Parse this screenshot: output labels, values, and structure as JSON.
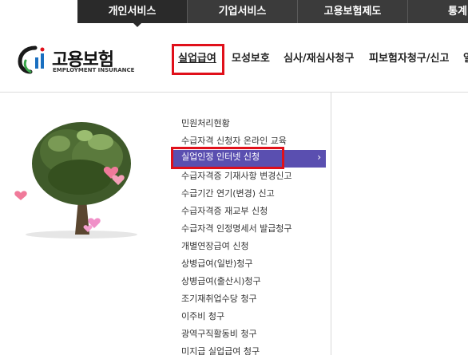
{
  "topnav": {
    "items": [
      {
        "label": "개인서비스"
      },
      {
        "label": "기업서비스"
      },
      {
        "label": "고용보험제도"
      },
      {
        "label": "통계"
      }
    ]
  },
  "logo": {
    "kor": "고용보험",
    "eng": "EMPLOYMENT INSURANCE"
  },
  "mainnav": {
    "items": [
      {
        "label": "실업급여"
      },
      {
        "label": "모성보호"
      },
      {
        "label": "심사/재심사청구"
      },
      {
        "label": "피보험자청구/신고"
      },
      {
        "label": "일"
      }
    ]
  },
  "submenu": {
    "items": [
      {
        "label": "민원처리현황"
      },
      {
        "label": "수급자격 신청자 온라인 교육"
      },
      {
        "label": "실업인정 인터넷 신청"
      },
      {
        "label": "수급자격증 기재사항 변경신고"
      },
      {
        "label": "수급기간 연기(변경) 신고"
      },
      {
        "label": "수급자격증 재교부 신청"
      },
      {
        "label": "수급자격 인정명세서 발급청구"
      },
      {
        "label": "개별연장급여 신청"
      },
      {
        "label": "상병급여(일반)청구"
      },
      {
        "label": "상병급여(출산시)청구"
      },
      {
        "label": "조기재취업수당 청구"
      },
      {
        "label": "이주비 청구"
      },
      {
        "label": "광역구직활동비 청구"
      },
      {
        "label": "미지급 실업급여 청구"
      }
    ],
    "selected_chevron": "›"
  },
  "colors": {
    "topbar": "#3b3b3b",
    "highlight_red": "#e0101a",
    "selected_bg": "#5a4fb0"
  }
}
